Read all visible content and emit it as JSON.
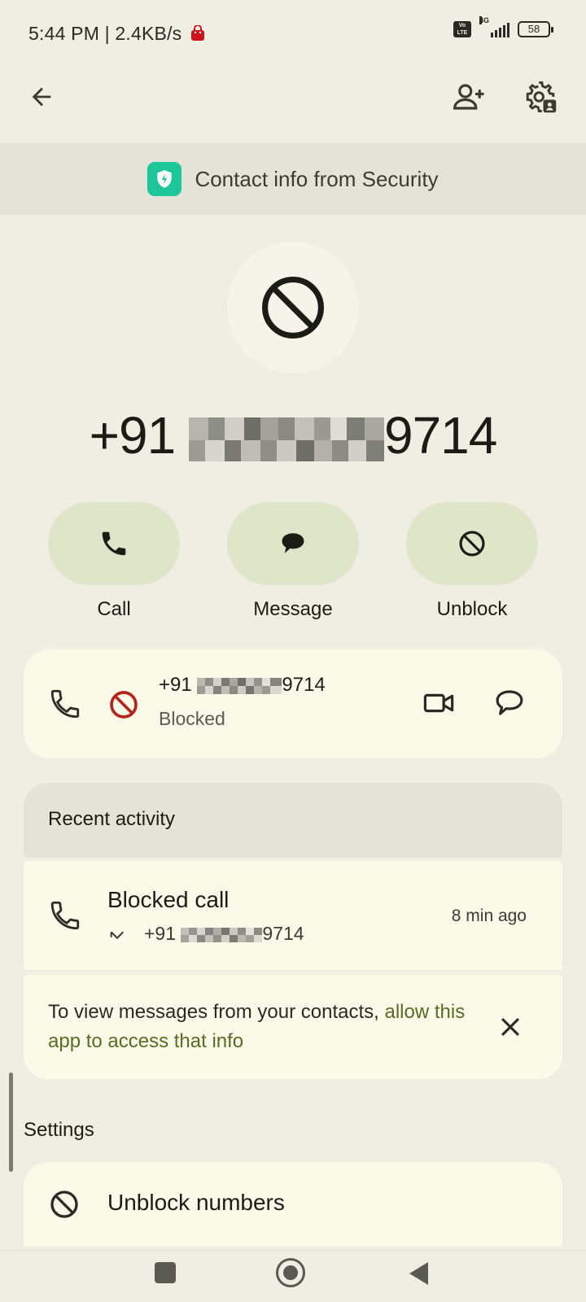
{
  "status_bar": {
    "time": "5:44 PM | 2.4KB/s",
    "network": "4G",
    "volte": "Vo LTE",
    "battery": "58"
  },
  "top_bar": {
    "back_icon": "arrow-back-icon",
    "add_contact_icon": "person-add-icon",
    "settings_icon": "contact-settings-icon"
  },
  "banner": {
    "text": "Contact info from Security",
    "icon": "shield-icon",
    "icon_color": "#1ec79a"
  },
  "contact": {
    "number_prefix": "+91 ",
    "number_suffix": "9714",
    "avatar_icon": "block-icon"
  },
  "actions": [
    {
      "label": "Call",
      "icon": "phone-icon"
    },
    {
      "label": "Message",
      "icon": "message-icon"
    },
    {
      "label": "Unblock",
      "icon": "block-icon"
    }
  ],
  "number_card": {
    "prefix": "+91 ",
    "suffix": "9714",
    "status": "Blocked",
    "status_icon_color": "#b3261e"
  },
  "recent_activity": {
    "title": "Recent activity",
    "item_title": "Blocked call",
    "item_prefix": "+91 ",
    "item_suffix": "9714",
    "item_time": "8 min ago"
  },
  "info_card": {
    "text": "To view messages from your contacts, ",
    "link": "allow this app to access that info",
    "link_color": "#5a6b23"
  },
  "settings": {
    "label": "Settings",
    "unblock_numbers": "Unblock numbers"
  },
  "nav": {
    "recents_icon": "square-icon",
    "home_icon": "circle-icon",
    "back_icon": "triangle-back-icon"
  }
}
